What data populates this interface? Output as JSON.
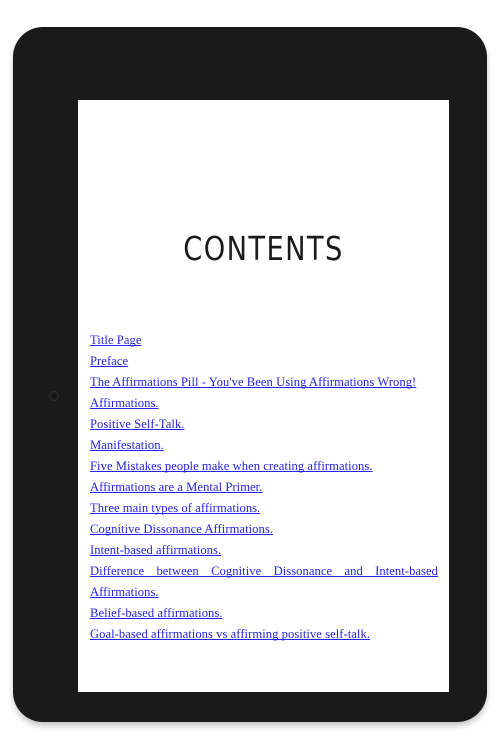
{
  "device": {
    "type": "tablet-ereader",
    "frame_color": "#1a1a1a",
    "camera_label": "front-camera"
  },
  "page": {
    "background": "#ffffff",
    "title": "CONTENTS",
    "link_color": "#2424e8",
    "text_color": "#1b1b1b"
  },
  "toc": {
    "items": [
      {
        "label": "Title Page",
        "justified": false
      },
      {
        "label": "Preface",
        "justified": false
      },
      {
        "label": "The Affirmations Pill - You've Been Using Affirmations Wrong!",
        "justified": false
      },
      {
        "label": "Affirmations.",
        "justified": false
      },
      {
        "label": "Positive Self-Talk.",
        "justified": false
      },
      {
        "label": "Manifestation.",
        "justified": false
      },
      {
        "label": "Five Mistakes people make when creating affirmations.",
        "justified": false
      },
      {
        "label": "Affirmations are a Mental Primer.",
        "justified": false
      },
      {
        "label": "Three main types of affirmations.",
        "justified": false
      },
      {
        "label": "Cognitive Dissonance Affirmations.",
        "justified": false
      },
      {
        "label": "Intent-based affirmations.",
        "justified": false
      },
      {
        "label": "Difference between  Cognitive Dissonance and Intent-based Affirmations.",
        "justified": true
      },
      {
        "label": "Belief-based affirmations.",
        "justified": false
      },
      {
        "label": "Goal-based affirmations vs affirming positive self-talk.",
        "justified": false
      }
    ]
  }
}
